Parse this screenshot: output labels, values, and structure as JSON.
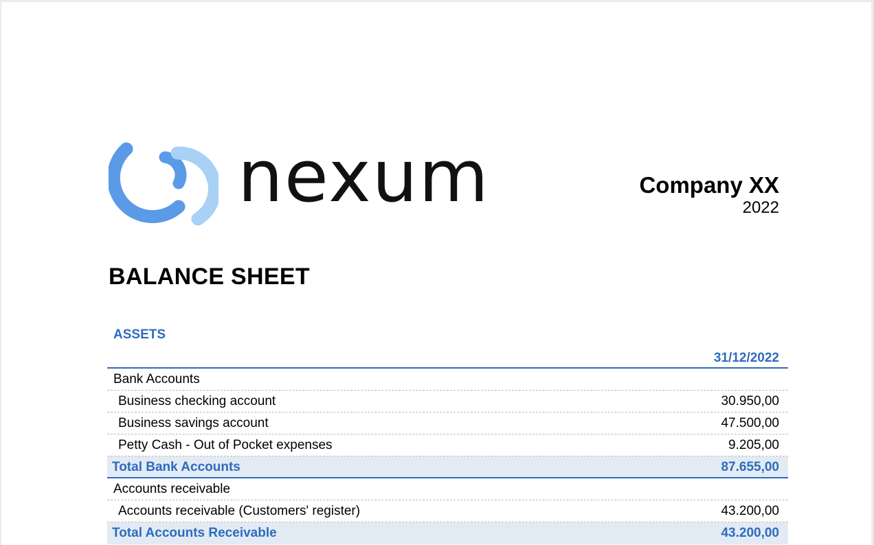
{
  "logo": {
    "wordmark": "nexum",
    "mark_icon": "circular-swirl-icon",
    "colors": {
      "primary": "#5b9ae6",
      "light": "#a9d0f5"
    }
  },
  "company": {
    "name": "Company XX",
    "year": "2022"
  },
  "document": {
    "title": "BALANCE SHEET"
  },
  "assets": {
    "label": "ASSETS",
    "date_column": "31/12/2022",
    "rows": [
      {
        "type": "group",
        "label": "Bank Accounts",
        "value": ""
      },
      {
        "type": "item",
        "label": "Business checking account",
        "value": "30.950,00"
      },
      {
        "type": "item",
        "label": "Business savings account",
        "value": "47.500,00"
      },
      {
        "type": "item",
        "label": "Petty Cash - Out of Pocket expenses",
        "value": "9.205,00"
      },
      {
        "type": "total",
        "label": "Total Bank Accounts",
        "value": "87.655,00"
      },
      {
        "type": "group",
        "label": "Accounts receivable",
        "value": ""
      },
      {
        "type": "item",
        "label": "Accounts receivable (Customers' register)",
        "value": "43.200,00"
      },
      {
        "type": "total",
        "label": "Total Accounts Receivable",
        "value": "43.200,00"
      }
    ]
  },
  "colors": {
    "accent": "#2e6bbd",
    "total_row_bg": "#e2ebf4",
    "dashed_divider": "#b9b9b9"
  }
}
